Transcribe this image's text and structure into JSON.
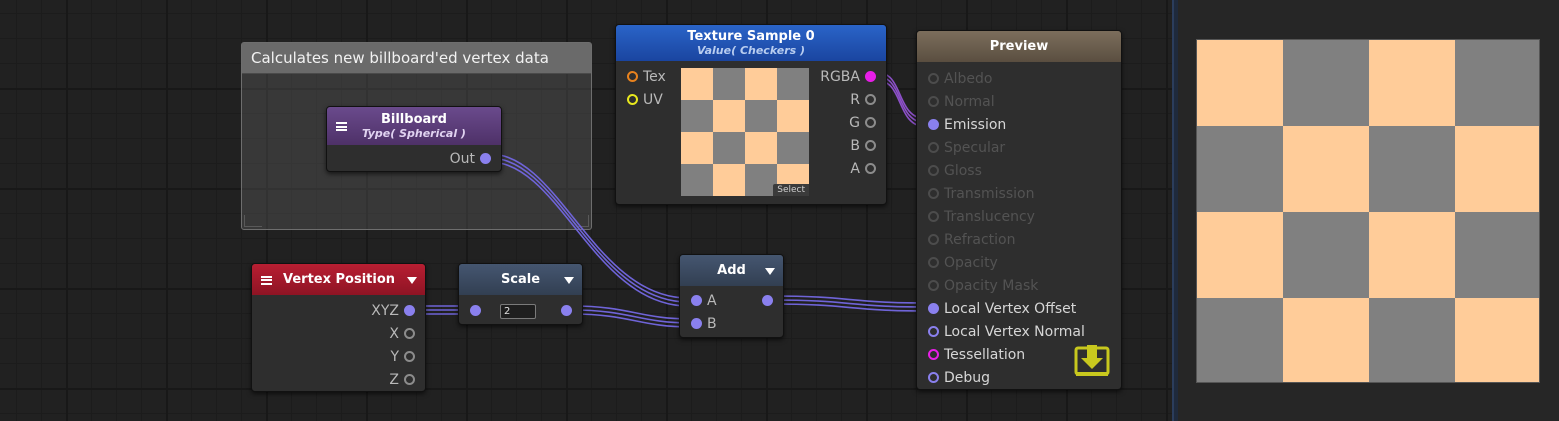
{
  "comment": {
    "title": "Calculates new billboard'ed vertex data"
  },
  "billboard_node": {
    "title": "Billboard",
    "subtitle": "Type( Spherical )",
    "outputs": [
      "Out"
    ],
    "header_color": "#5e3f7d"
  },
  "texture_node": {
    "title": "Texture Sample 0",
    "subtitle": "Value( Checkers )",
    "inputs": [
      "Tex",
      "UV"
    ],
    "outputs": [
      "RGBA",
      "R",
      "G",
      "B",
      "A"
    ],
    "select_label": "Select",
    "header_color": "#1f54b3",
    "checker_colors": [
      "#ffcc99",
      "#808080"
    ]
  },
  "vertex_node": {
    "title": "Vertex Position",
    "outputs": [
      "XYZ",
      "X",
      "Y",
      "Z"
    ],
    "header_color": "#a3192c"
  },
  "scale_node": {
    "title": "Scale",
    "value": "2",
    "header_color": "#3c4a5e"
  },
  "add_node": {
    "title": "Add",
    "inputs": [
      "A",
      "B"
    ],
    "header_color": "#3c4a5e"
  },
  "preview_node": {
    "title": "Preview",
    "header_color": "#6e6253",
    "inputs": [
      {
        "label": "Albedo",
        "state": "disabled"
      },
      {
        "label": "Normal",
        "state": "disabled"
      },
      {
        "label": "Emission",
        "state": "connected"
      },
      {
        "label": "Specular",
        "state": "disabled"
      },
      {
        "label": "Gloss",
        "state": "disabled"
      },
      {
        "label": "Transmission",
        "state": "disabled"
      },
      {
        "label": "Translucency",
        "state": "disabled"
      },
      {
        "label": "Refraction",
        "state": "disabled"
      },
      {
        "label": "Opacity",
        "state": "disabled"
      },
      {
        "label": "Opacity Mask",
        "state": "disabled"
      },
      {
        "label": "Local Vertex Offset",
        "state": "connected"
      },
      {
        "label": "Local Vertex Normal",
        "state": "open"
      },
      {
        "label": "Tessellation",
        "state": "open-magenta"
      },
      {
        "label": "Debug",
        "state": "open"
      }
    ],
    "save_icon": "save-download-icon",
    "save_icon_color": "#c8c81e"
  },
  "side_preview": {
    "checker_colors": [
      "#ffcc99",
      "#808080"
    ]
  },
  "colors": {
    "wire": "#7b6fe0",
    "canvas": "#212121",
    "port": "#8a80ee"
  }
}
